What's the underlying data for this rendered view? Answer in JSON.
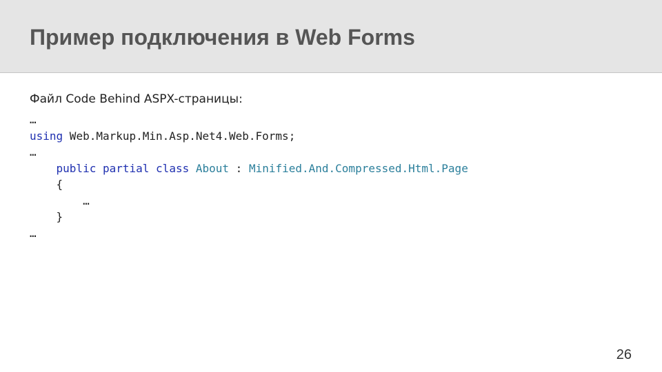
{
  "slide": {
    "title": "Пример подключения в Web Forms",
    "subtitle": "Файл Code Behind ASPX-страницы:",
    "page_number": "26"
  },
  "code": {
    "line1": "…",
    "line2_kw": "using",
    "line2_rest": " Web.Markup.Min.Asp.Net4.Web.Forms;",
    "line3": "…",
    "line4_indent": "    ",
    "line4_kw1": "public",
    "line4_kw2": "partial",
    "line4_kw3": "class",
    "line4_class": "About",
    "line4_sep": " : ",
    "line4_base": "Minified.And.Compressed.Html.Page",
    "line5": "    {",
    "line6": "        …",
    "line7": "    }",
    "line8": "…"
  },
  "colors": {
    "header_bg": "#e5e5e5",
    "keyword": "#1f30b0",
    "type_name": "#2b7f9b"
  }
}
